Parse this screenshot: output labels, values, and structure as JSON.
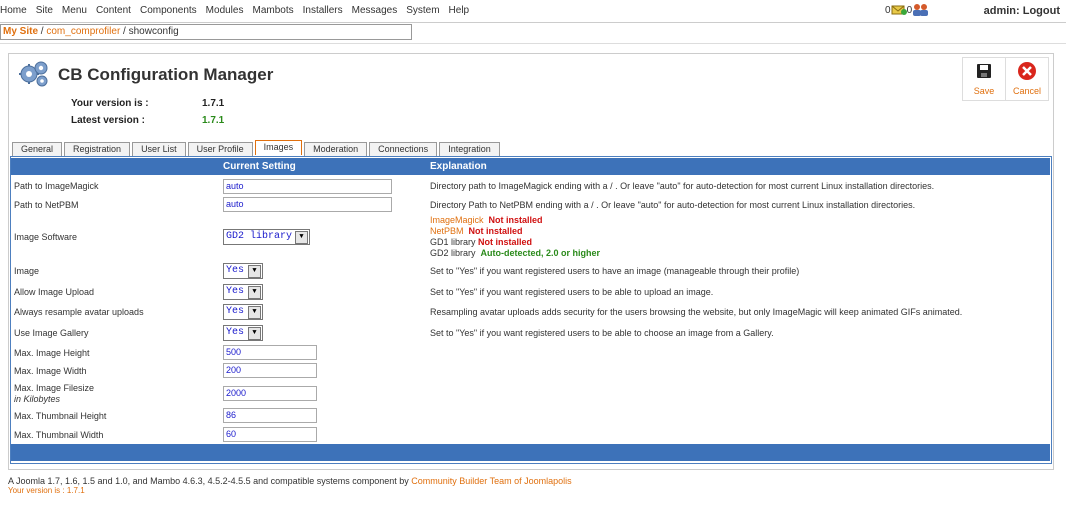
{
  "menu": [
    "Home",
    "Site",
    "Menu",
    "Content",
    "Components",
    "Modules",
    "Mambots",
    "Installers",
    "Messages",
    "System",
    "Help"
  ],
  "status": {
    "count1": "0",
    "count2": "0"
  },
  "admin_label": "admin: Logout",
  "breadcrumb": {
    "home": "My Site",
    "sep1": " / ",
    "mid": "com_comprofiler",
    "sep2": " / ",
    "current": "showconfig"
  },
  "header": {
    "title": "CB Configuration Manager",
    "your_version_label": "Your version is :",
    "your_version_value": "1.7.1",
    "latest_version_label": "Latest version :",
    "latest_version_value": "1.7.1"
  },
  "toolbar": {
    "save_label": "Save",
    "cancel_label": "Cancel"
  },
  "tabs": [
    "General",
    "Registration",
    "User List",
    "User Profile",
    "Images",
    "Moderation",
    "Connections",
    "Integration"
  ],
  "table": {
    "col_current": "Current Setting",
    "col_explanation": "Explanation",
    "rows": {
      "imagemagick": {
        "label": "Path to ImageMagick",
        "value": "auto",
        "exp": "Directory path to ImageMagick ending with a / . Or leave \"auto\" for auto-detection for most current Linux installation directories."
      },
      "netpbm": {
        "label": "Path to NetPBM",
        "value": "auto",
        "exp": "Directory Path to NetPBM ending with a / . Or leave \"auto\" for auto-detection for most current Linux installation directories."
      },
      "software": {
        "label": "Image Software",
        "value": "GD2 library",
        "libs": [
          {
            "name": "ImageMagick",
            "status": "Not installed"
          },
          {
            "name": "NetPBM",
            "status": "Not installed"
          },
          {
            "name": "GD1 library",
            "status": "Not installed"
          },
          {
            "name": "GD2 library",
            "status": "Auto-detected, 2.0 or higher"
          }
        ]
      },
      "image": {
        "label": "Image",
        "value": "Yes",
        "exp": "Set to \"Yes\" if you want registered users to have an image (manageable through their profile)"
      },
      "upload": {
        "label": "Allow Image Upload",
        "value": "Yes",
        "exp": "Set to \"Yes\" if you want registered users to be able to upload an image."
      },
      "resample": {
        "label": "Always resample avatar uploads",
        "value": "Yes",
        "exp": "Resampling avatar uploads adds security for the users browsing the website, but only ImageMagic will keep animated GIFs animated."
      },
      "gallery": {
        "label": "Use Image Gallery",
        "value": "Yes",
        "exp": "Set to \"Yes\" if you want registered users to be able to choose an image from a Gallery."
      },
      "max_height": {
        "label": "Max. Image Height",
        "value": "500"
      },
      "max_width": {
        "label": "Max. Image Width",
        "value": "200"
      },
      "max_filesize": {
        "label": "Max. Image Filesize",
        "sublabel": "in Kilobytes",
        "value": "2000"
      },
      "thumb_height": {
        "label": "Max. Thumbnail Height",
        "value": "86"
      },
      "thumb_width": {
        "label": "Max. Thumbnail Width",
        "value": "60"
      }
    }
  },
  "footer": {
    "text": "A Joomla 1.7, 1.6, 1.5 and 1.0, and Mambo 4.6.3, 4.5.2-4.5.5 and compatible systems component by ",
    "link": "Community Builder Team of Joomlapolis",
    "version_line": "Your version is : 1.7.1"
  },
  "colors": {
    "accent": "#e0700f",
    "header_bar": "#3d72b9",
    "green": "#2a8a1a",
    "red": "#d01010"
  }
}
